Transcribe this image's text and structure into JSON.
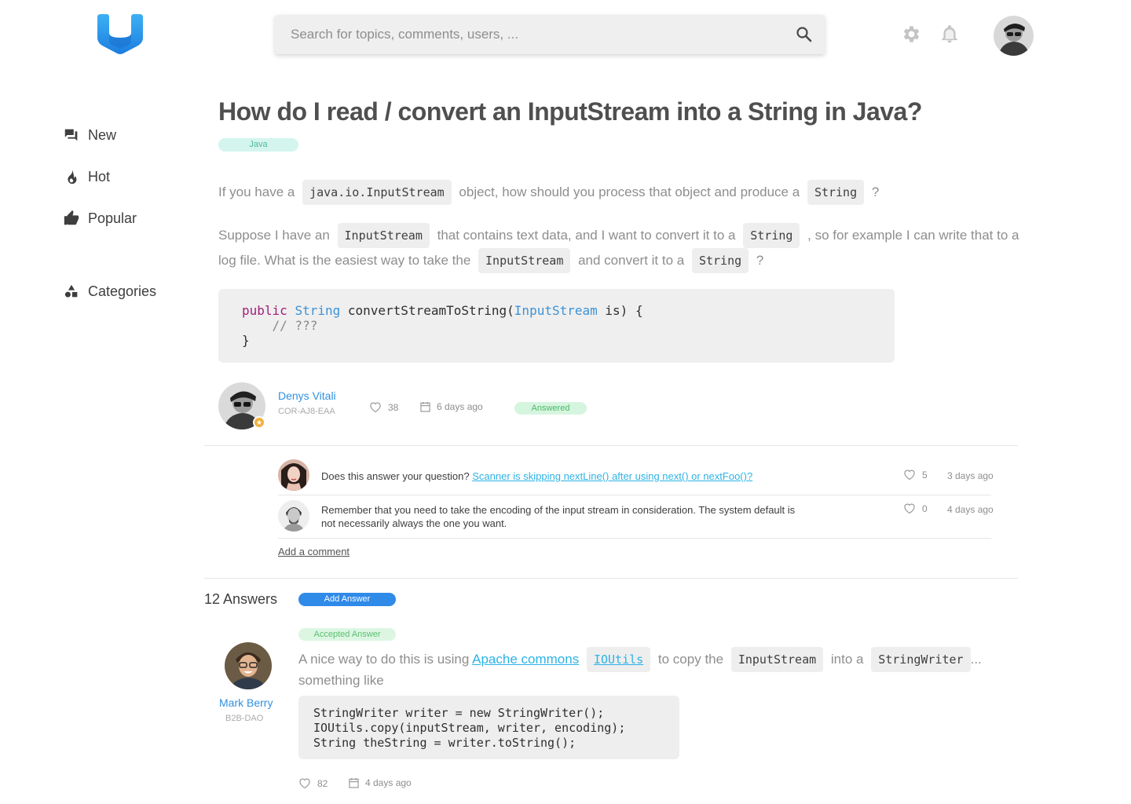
{
  "header": {
    "search_placeholder": "Search for topics, comments, users, ...",
    "icons": [
      "logo",
      "search-icon",
      "gear-icon",
      "bell-icon",
      "avatar"
    ]
  },
  "sidebar": {
    "items": [
      {
        "label": "New",
        "icon": "chat-icon"
      },
      {
        "label": "Hot",
        "icon": "flame-icon"
      },
      {
        "label": "Popular",
        "icon": "thumbs-up-icon"
      },
      {
        "label": "Categories",
        "icon": "shapes-icon"
      }
    ]
  },
  "question": {
    "title": "How do I read / convert an InputStream into a String in Java?",
    "tag": "Java",
    "p1": {
      "t1": "If you have a",
      "c1": "java.io.InputStream",
      "t2": "object, how should you process that object and produce a",
      "c2": "String",
      "t3": "?"
    },
    "p2": {
      "t1": "Suppose I have an",
      "c1": "InputStream",
      "t2": "that contains text data, and I want to convert it to a",
      "c2": "String",
      "t3": ", so for example I can write that to a log file.   What is the easiest way to take the",
      "c3": "InputStream",
      "t4": "and convert it to a",
      "c4": "String",
      "t5": "?"
    },
    "code": {
      "kw": "public",
      "type1": "String",
      "fn": "convertStreamToString(",
      "type2": "InputStream",
      "rest": "is) {",
      "comment": "// ???",
      "close": "}"
    },
    "author": {
      "name": "Denys Vitali",
      "id": "COR-AJ8-EAA"
    },
    "likes": "38",
    "date": "6 days ago",
    "status": "Answered"
  },
  "comments": [
    {
      "text": "Does this answer your question?",
      "link": "Scanner is skipping nextLine() after using next() or nextFoo()?",
      "likes": "5",
      "date": "3 days ago"
    },
    {
      "text": "Remember that you need to take the encoding of the input stream in consideration. The system default is not necessarily always the one you want.",
      "likes": "0",
      "date": "4 days ago"
    }
  ],
  "add_comment": "Add a comment",
  "answers": {
    "count_label": "12 Answers",
    "add_label": "Add Answer",
    "accepted_label": "Accepted Answer",
    "author": {
      "name": "Mark Berry",
      "id": "B2B-DAO"
    },
    "text": {
      "t1": "A nice way to do this is using",
      "link": "Apache commons",
      "c1": "IOUtils",
      "t2": "to copy the",
      "c2": "InputStream",
      "t3": "into a",
      "c3": "StringWriter",
      "t4": "... something like"
    },
    "code_lines": [
      "StringWriter writer = new StringWriter();",
      "IOUtils.copy(inputStream, writer, encoding);",
      "String theString = writer.toString();"
    ],
    "likes": "82",
    "date": "4 days ago"
  },
  "colors": {
    "accent": "#2f8ae8",
    "link": "#2cb3e6",
    "tag_bg": "#d3f5ee",
    "answered_bg": "#d6f5df"
  }
}
